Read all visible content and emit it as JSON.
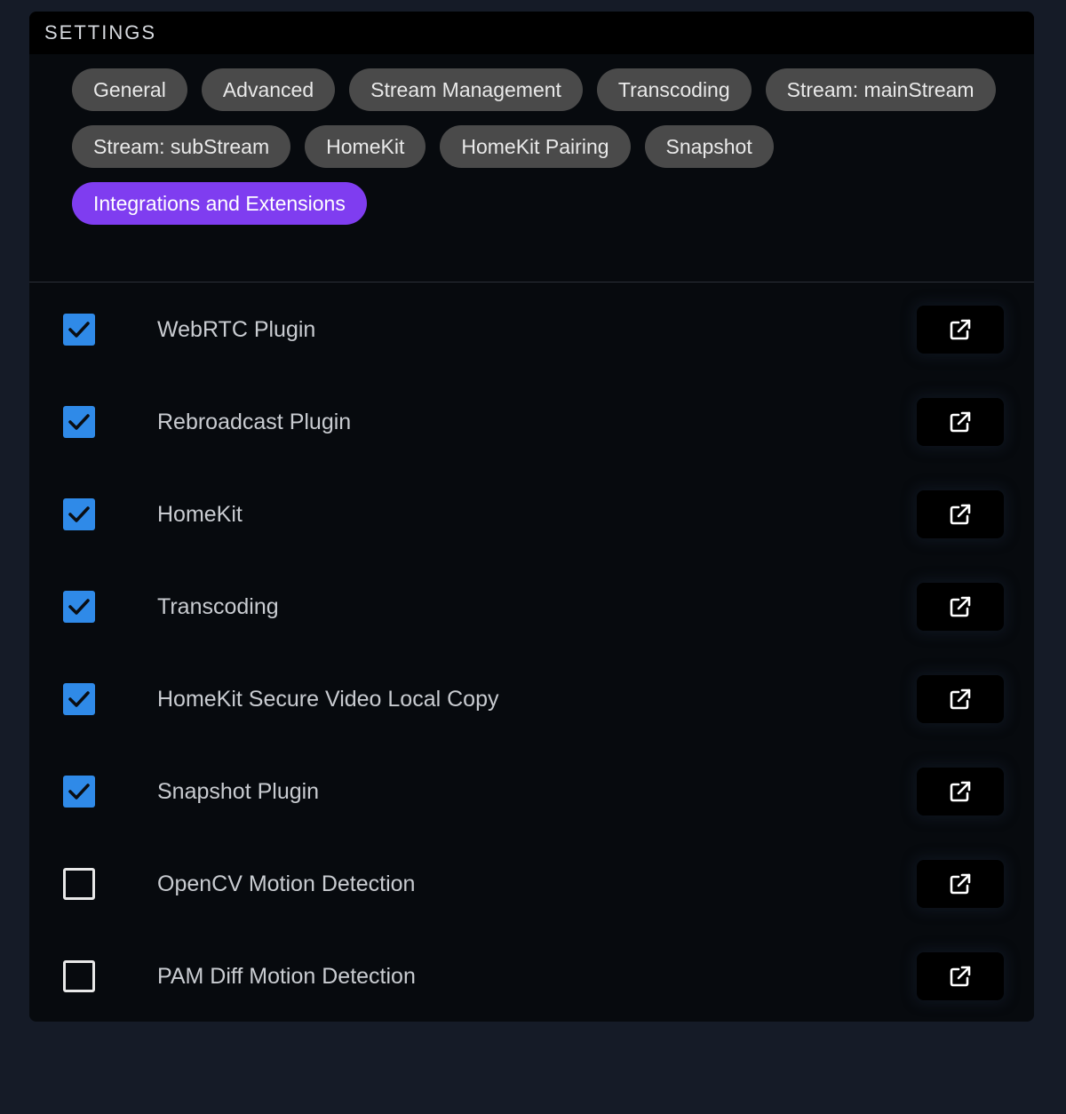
{
  "header": {
    "title": "SETTINGS"
  },
  "tabs": [
    {
      "label": "General",
      "active": false
    },
    {
      "label": "Advanced",
      "active": false
    },
    {
      "label": "Stream Management",
      "active": false
    },
    {
      "label": "Transcoding",
      "active": false
    },
    {
      "label": "Stream: mainStream",
      "active": false
    },
    {
      "label": "Stream: subStream",
      "active": false
    },
    {
      "label": "HomeKit",
      "active": false
    },
    {
      "label": "HomeKit Pairing",
      "active": false
    },
    {
      "label": "Snapshot",
      "active": false
    },
    {
      "label": "Integrations and Extensions",
      "active": true
    }
  ],
  "integrations": [
    {
      "label": "WebRTC Plugin",
      "checked": true,
      "icon": "external-link-icon"
    },
    {
      "label": "Rebroadcast Plugin",
      "checked": true,
      "icon": "external-link-icon"
    },
    {
      "label": "HomeKit",
      "checked": true,
      "icon": "external-link-icon"
    },
    {
      "label": "Transcoding",
      "checked": true,
      "icon": "external-link-icon"
    },
    {
      "label": "HomeKit Secure Video Local Copy",
      "checked": true,
      "icon": "external-link-icon"
    },
    {
      "label": "Snapshot Plugin",
      "checked": true,
      "icon": "external-link-icon"
    },
    {
      "label": "OpenCV Motion Detection",
      "checked": false,
      "icon": "external-link-icon"
    },
    {
      "label": "PAM Diff Motion Detection",
      "checked": false,
      "icon": "external-link-icon"
    }
  ],
  "colors": {
    "accent": "#7f3df0",
    "checkbox": "#2f8ae8",
    "chip": "#4a4a4a",
    "background": "#151b27",
    "panel": "#070a0e"
  }
}
